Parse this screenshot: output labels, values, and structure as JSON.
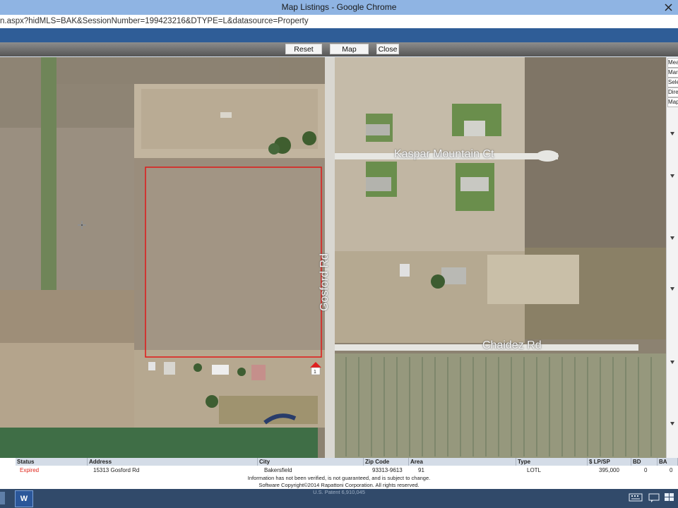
{
  "window": {
    "title": "Map Listings - Google Chrome"
  },
  "address": {
    "url": "n.aspx?hidMLS=BAK&SessionNumber=199423216&DTYPE=L&datasource=Property"
  },
  "toolbar": {
    "reset_label": "Reset Map",
    "report_label": "Map Report",
    "close_label": "Close"
  },
  "map": {
    "labels": {
      "kaspar": "Kaspar Mountain Ct",
      "gosford": "Gosford Rd",
      "chaidez": "Chaidez Rd"
    },
    "marker_number": "1"
  },
  "side_buttons": [
    "Mea",
    "Mar",
    "Sele",
    "Dire",
    "Map"
  ],
  "table": {
    "headers": [
      "Status",
      "Address",
      "City",
      "Zip Code",
      "Area",
      "Type",
      "$ LP/SP",
      "BD",
      "BA"
    ],
    "row": {
      "status": "Expired",
      "address": "15313 Gosford Rd",
      "city": "Bakersfield",
      "zip": "93313-9613",
      "area": "91",
      "type": "LOTL",
      "price": "395,000",
      "bd": "0",
      "ba": "0"
    },
    "footer_1": "Information has not been verified, is not guaranteed, and is subject to change.",
    "footer_2": "Software Copyright©2014 Rapattoni Corporation. All rights reserved.",
    "footer_3": "U.S. Patent 6,910,045"
  },
  "taskbar": {
    "word_label": "W"
  },
  "colors": {
    "title_bg": "#8fb4e3",
    "band_bg": "#2f5d97",
    "expired": "#e0261b",
    "parcel": "#e01818"
  }
}
